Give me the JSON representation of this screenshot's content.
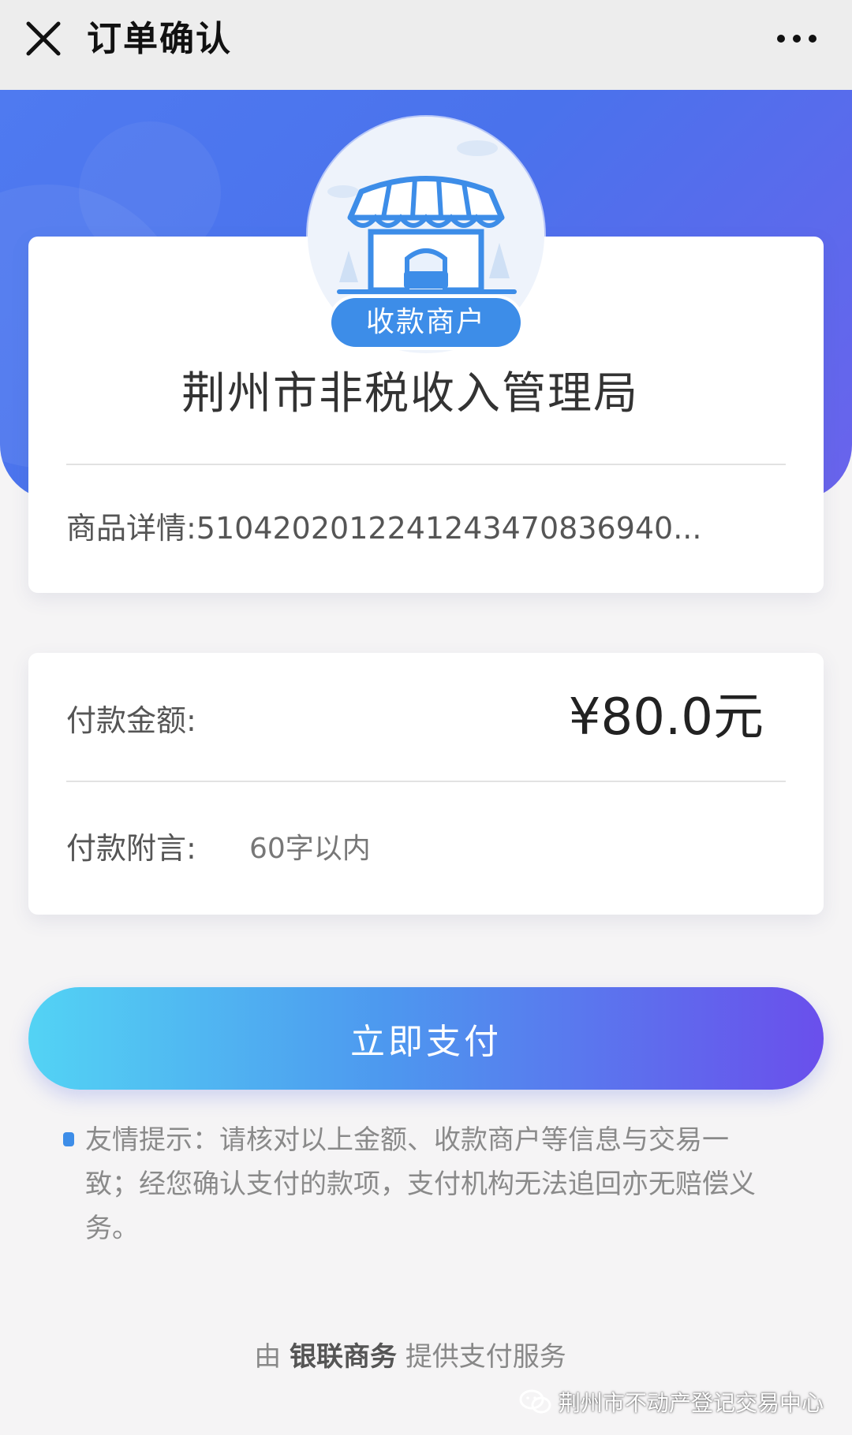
{
  "topbar": {
    "title": "订单确认",
    "close_icon": "close-icon",
    "more_icon": "more-dots-icon"
  },
  "merchant": {
    "badge": "收款商户",
    "avatar_icon": "storefront-icon",
    "name": "荆州市非税收入管理局",
    "goods_detail": "商品详情:510420201224124347083694​0..."
  },
  "payment": {
    "amount_label": "付款金额:",
    "amount": "¥80.0元",
    "remark_label": "付款附言:",
    "remark_placeholder": "60字以内",
    "remark_value": ""
  },
  "pay_button": {
    "label": "立即支付"
  },
  "tip": {
    "text": "友情提示：请核对以上金额、收款商户等信息与交易一致；经您确认支付的款项，支付机构无法追回亦无赔偿义务。"
  },
  "footer": {
    "prefix": "由",
    "brand": "银联商务",
    "suffix": "提供支付服务"
  },
  "watermark": {
    "text": "荆州市不动产登记交易中心",
    "icon": "wechat-icon"
  },
  "colors": {
    "accent_blue": "#3d8de8",
    "header_gradient_start": "#4f7af0",
    "header_gradient_end": "#6a63ec",
    "button_gradient_start": "#53d3f4",
    "button_gradient_end": "#6a4fec"
  }
}
